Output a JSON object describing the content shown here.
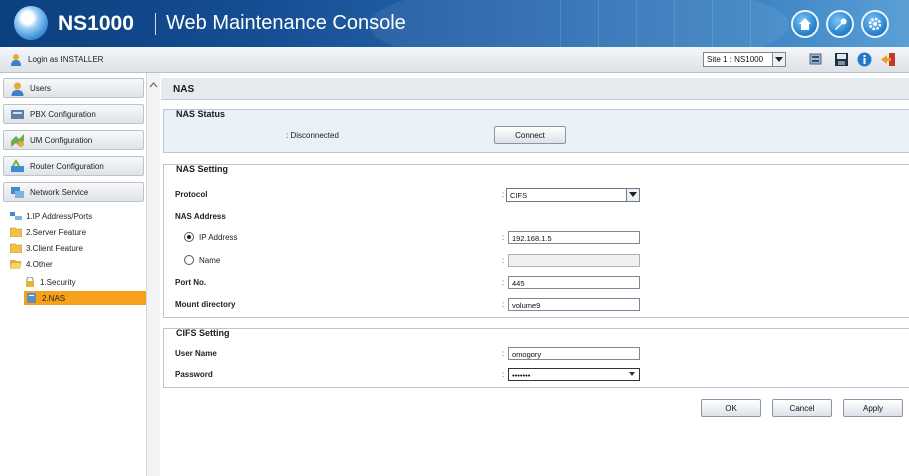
{
  "header": {
    "brand": "NS1000",
    "title": "Web Maintenance Console"
  },
  "toolbar": {
    "login_text": "Login as INSTALLER",
    "site_select_value": "Site 1 : NS1000"
  },
  "sidebar": {
    "nav_buttons": [
      {
        "label": "Users",
        "icon": "users-icon"
      },
      {
        "label": "PBX Configuration",
        "icon": "pbx-icon"
      },
      {
        "label": "UM Configuration",
        "icon": "um-icon"
      },
      {
        "label": "Router Configuration",
        "icon": "router-icon"
      },
      {
        "label": "Network Service",
        "icon": "network-icon"
      }
    ],
    "tree": [
      {
        "label": "1.IP Address/Ports",
        "icon": "network-ports-icon"
      },
      {
        "label": "2.Server Feature",
        "icon": "folder-icon"
      },
      {
        "label": "3.Client Feature",
        "icon": "folder-icon"
      },
      {
        "label": "4.Other",
        "icon": "folder-open-icon"
      },
      {
        "label": "1.Security",
        "icon": "lock-icon"
      },
      {
        "label": "2.NAS",
        "icon": "nas-icon"
      }
    ]
  },
  "main": {
    "page_title": "NAS",
    "nas_status": {
      "legend": "NAS Status",
      "status_value": ": Disconnected",
      "connect_label": "Connect"
    },
    "nas_setting": {
      "legend": "NAS Setting",
      "protocol_label": "Protocol",
      "protocol_value": "CIFS",
      "nas_address_label": "NAS Address",
      "ip_address_label": "IP Address",
      "ip_address_value": "192.168.1.5",
      "name_label": "Name",
      "name_value": "",
      "port_label": "Port No.",
      "port_value": "445",
      "mount_label": "Mount directory",
      "mount_value": "volume9"
    },
    "cifs_setting": {
      "legend": "CIFS Setting",
      "user_name_label": "User Name",
      "user_name_value": "omogory",
      "password_label": "Password",
      "password_value": "•••••••"
    },
    "buttons": {
      "ok": "OK",
      "cancel": "Cancel",
      "apply": "Apply"
    }
  },
  "colors": {
    "header_dark": "#0c3f7e",
    "header_light": "#5aa0d6",
    "selected_item": "#f7a11a",
    "section_bg": "#eaf1f8"
  }
}
